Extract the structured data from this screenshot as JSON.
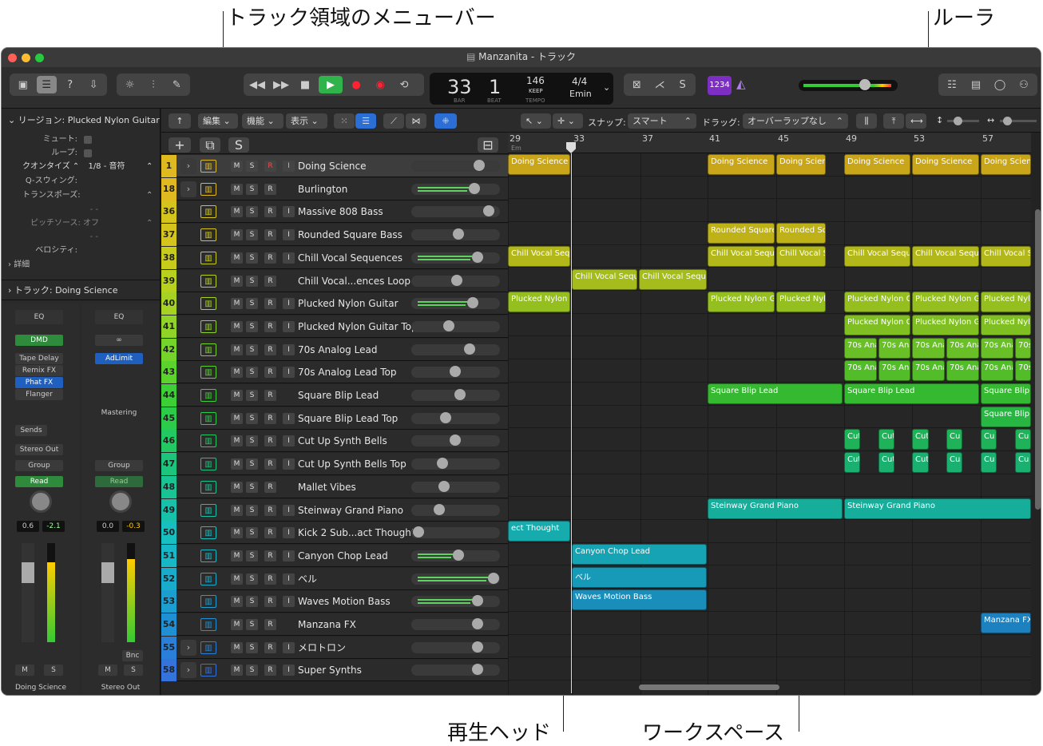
{
  "callouts": {
    "menu": "トラック領域のメニューバー",
    "ruler": "ルーラ",
    "playhead": "再生ヘッド",
    "workspace": "ワークスペース"
  },
  "window": {
    "title": "Manzanita - トラック"
  },
  "lcd": {
    "bar": "33",
    "beat": "1",
    "bar_label": "BAR",
    "beat_label": "BEAT",
    "tempo": "146",
    "tempo_mode": "KEEP",
    "tempo_label": "TEMPO",
    "sig": "4/4",
    "key": "Emin"
  },
  "toolbar": {
    "count_in": "1234"
  },
  "inspector": {
    "region_header": "リージョン: Plucked Nylon Guitar",
    "mute": "ミュート:",
    "loop": "ループ:",
    "quantize": "クオンタイズ",
    "quantize_value": "1/8 - 音符",
    "qswing": "Q-スウィング:",
    "transpose": "トランスポーズ:",
    "dash1": "- -",
    "pitch_source": "ピッチソース: オフ",
    "dash2": "- -",
    "velocity": "ベロシティ:",
    "details": "詳細",
    "track_header": "トラック: Doing Science"
  },
  "strip1": {
    "eq": "EQ",
    "fx": [
      "DMD",
      "Tape Delay",
      "Remix FX",
      "Phat FX",
      "Flanger"
    ],
    "sends": "Sends",
    "out": "Stereo Out",
    "group": "Group",
    "auto": "Read",
    "vol": "0.6",
    "peak": "-2.1",
    "m": "M",
    "s": "S",
    "name": "Doing Science"
  },
  "strip2": {
    "eq": "EQ",
    "fx": [
      "AdLimit"
    ],
    "mastering": "Mastering",
    "group": "Group",
    "auto": "Read",
    "vol": "0.0",
    "peak": "-0.3",
    "bnc": "Bnc",
    "m": "M",
    "s": "S",
    "name": "Stereo Out"
  },
  "menubar": {
    "edit": "編集",
    "func": "機能",
    "view": "表示",
    "snap_label": "スナップ:",
    "snap": "スマート",
    "drag_label": "ドラッグ:",
    "drag": "オーバーラップなし"
  },
  "headerbar": {
    "add": "+",
    "dup": "⧉",
    "solo": "S"
  },
  "ruler": {
    "bars": [
      "29",
      "33",
      "37",
      "41",
      "45",
      "49",
      "53",
      "57"
    ],
    "key": "Em"
  },
  "tracks": [
    {
      "num": "1",
      "name": "Doing Science",
      "color": "#e0b81f"
    },
    {
      "num": "18",
      "name": "Burlington",
      "color": "#e0b81f"
    },
    {
      "num": "36",
      "name": "Massive 808 Bass",
      "color": "#d4c41b"
    },
    {
      "num": "37",
      "name": "Rounded Square Bass",
      "color": "#d4c41b"
    },
    {
      "num": "38",
      "name": "Chill Vocal Sequences",
      "color": "#c7cc1c"
    },
    {
      "num": "39",
      "name": "Chill Vocal...ences Loop",
      "color": "#b8d11f"
    },
    {
      "num": "40",
      "name": "Plucked Nylon Guitar",
      "color": "#a6d323"
    },
    {
      "num": "41",
      "name": "Plucked Nylon Guitar Top",
      "color": "#8fd426"
    },
    {
      "num": "42",
      "name": "70s Analog Lead",
      "color": "#74d42a"
    },
    {
      "num": "43",
      "name": "70s Analog Lead Top",
      "color": "#5cd32d"
    },
    {
      "num": "44",
      "name": "Square Blip Lead",
      "color": "#3ccf36"
    },
    {
      "num": "45",
      "name": "Square Blip Lead Top",
      "color": "#2ccc4a"
    },
    {
      "num": "46",
      "name": "Cut Up Synth Bells",
      "color": "#22c862"
    },
    {
      "num": "47",
      "name": "Cut Up Synth Bells Top",
      "color": "#1cc47c"
    },
    {
      "num": "48",
      "name": "Mallet Vibes",
      "color": "#1ac394"
    },
    {
      "num": "49",
      "name": "Steinway Grand Piano",
      "color": "#18c1aa"
    },
    {
      "num": "50",
      "name": "Kick 2 Sub...act Thought",
      "color": "#18bfc0"
    },
    {
      "num": "51",
      "name": "Canyon Chop Lead",
      "color": "#18b7c8"
    },
    {
      "num": "52",
      "name": "ベル",
      "color": "#19abcc"
    },
    {
      "num": "53",
      "name": "Waves Motion Bass",
      "color": "#1c9fd0"
    },
    {
      "num": "54",
      "name": "Manzana FX",
      "color": "#2090d4"
    },
    {
      "num": "55",
      "name": "メロトロン",
      "color": "#2a80d8"
    },
    {
      "num": "58",
      "name": "Super Synths",
      "color": "#3472dc"
    }
  ],
  "regions": [
    {
      "lane": 0,
      "name": "Doing Science",
      "from": 0,
      "to": 78,
      "c": "#c9a51a"
    },
    {
      "lane": 0,
      "name": "Doing Science",
      "from": 250,
      "to": 334,
      "c": "#c9a51a"
    },
    {
      "lane": 0,
      "name": "Doing Science",
      "from": 336,
      "to": 398,
      "c": "#c9a51a"
    },
    {
      "lane": 0,
      "name": "Doing Science",
      "from": 421,
      "to": 504,
      "c": "#c9a51a"
    },
    {
      "lane": 0,
      "name": "Doing Science",
      "from": 506,
      "to": 590,
      "c": "#c9a51a"
    },
    {
      "lane": 0,
      "name": "Doing Science",
      "from": 592,
      "to": 655,
      "c": "#c9a51a"
    },
    {
      "lane": 3,
      "name": "Rounded Square",
      "from": 250,
      "to": 334,
      "c": "#bfb218"
    },
    {
      "lane": 3,
      "name": "Rounded Sq",
      "from": 336,
      "to": 398,
      "c": "#bfb218"
    },
    {
      "lane": 4,
      "name": "Chill Vocal Seque",
      "from": 0,
      "to": 78,
      "c": "#b3b81a"
    },
    {
      "lane": 4,
      "name": "Chill Vocal Seque",
      "from": 250,
      "to": 334,
      "c": "#b3b81a"
    },
    {
      "lane": 4,
      "name": "Chill Vocal S",
      "from": 336,
      "to": 398,
      "c": "#b3b81a"
    },
    {
      "lane": 4,
      "name": "Chill Vocal Seque",
      "from": 421,
      "to": 504,
      "c": "#b3b81a"
    },
    {
      "lane": 4,
      "name": "Chill Vocal Seque",
      "from": 506,
      "to": 590,
      "c": "#b3b81a"
    },
    {
      "lane": 4,
      "name": "Chill Vocal Se",
      "from": 592,
      "to": 655,
      "c": "#b3b81a"
    },
    {
      "lane": 5,
      "name": "Chill Vocal Seque",
      "from": 80,
      "to": 162,
      "c": "#a5bc1c"
    },
    {
      "lane": 5,
      "name": "Chill Vocal Seque",
      "from": 164,
      "to": 249,
      "c": "#a5bc1c"
    },
    {
      "lane": 6,
      "name": "Plucked Nylon G",
      "from": 0,
      "to": 78,
      "c": "#95be1f"
    },
    {
      "lane": 6,
      "name": "Plucked Nylon G",
      "from": 250,
      "to": 334,
      "c": "#95be1f"
    },
    {
      "lane": 6,
      "name": "Plucked Nyl",
      "from": 336,
      "to": 398,
      "c": "#95be1f"
    },
    {
      "lane": 6,
      "name": "Plucked Nylon G",
      "from": 421,
      "to": 504,
      "c": "#95be1f"
    },
    {
      "lane": 6,
      "name": "Plucked Nylon Gu",
      "from": 506,
      "to": 590,
      "c": "#95be1f"
    },
    {
      "lane": 6,
      "name": "Plucked Nylo",
      "from": 592,
      "to": 655,
      "c": "#95be1f"
    },
    {
      "lane": 7,
      "name": "Plucked Nylon G",
      "from": 421,
      "to": 504,
      "c": "#80bf22"
    },
    {
      "lane": 7,
      "name": "Plucked Nylon Gu",
      "from": 506,
      "to": 590,
      "c": "#80bf22"
    },
    {
      "lane": 7,
      "name": "Plucked Nylo",
      "from": 592,
      "to": 655,
      "c": "#80bf22"
    },
    {
      "lane": 8,
      "name": "70s Ana",
      "from": 421,
      "to": 462,
      "c": "#68bf26"
    },
    {
      "lane": 8,
      "name": "70s Ana",
      "from": 464,
      "to": 504,
      "c": "#68bf26"
    },
    {
      "lane": 8,
      "name": "70s Ana",
      "from": 506,
      "to": 547,
      "c": "#68bf26"
    },
    {
      "lane": 8,
      "name": "70s Ana",
      "from": 549,
      "to": 590,
      "c": "#68bf26"
    },
    {
      "lane": 8,
      "name": "70s Ana",
      "from": 592,
      "to": 633,
      "c": "#68bf26"
    },
    {
      "lane": 8,
      "name": "70s",
      "from": 635,
      "to": 655,
      "c": "#68bf26"
    },
    {
      "lane": 9,
      "name": "70s Ana",
      "from": 421,
      "to": 462,
      "c": "#52bd29"
    },
    {
      "lane": 9,
      "name": "70s Ana",
      "from": 464,
      "to": 504,
      "c": "#52bd29"
    },
    {
      "lane": 9,
      "name": "70s Ana",
      "from": 506,
      "to": 547,
      "c": "#52bd29"
    },
    {
      "lane": 9,
      "name": "70s Ana",
      "from": 549,
      "to": 590,
      "c": "#52bd29"
    },
    {
      "lane": 9,
      "name": "70s Ana",
      "from": 592,
      "to": 633,
      "c": "#52bd29"
    },
    {
      "lane": 9,
      "name": "70s",
      "from": 635,
      "to": 655,
      "c": "#52bd29"
    },
    {
      "lane": 10,
      "name": "Square Blip Lead",
      "from": 250,
      "to": 419,
      "c": "#35b930"
    },
    {
      "lane": 10,
      "name": "Square Blip Lead",
      "from": 421,
      "to": 590,
      "c": "#35b930"
    },
    {
      "lane": 10,
      "name": "Square Blip",
      "from": 592,
      "to": 655,
      "c": "#35b930"
    },
    {
      "lane": 11,
      "name": "Square Blip L",
      "from": 592,
      "to": 655,
      "c": "#27b642"
    },
    {
      "lane": 12,
      "name": "Cut",
      "from": 421,
      "to": 441,
      "c": "#1eb358"
    },
    {
      "lane": 12,
      "name": "Cut",
      "from": 464,
      "to": 484,
      "c": "#1eb358"
    },
    {
      "lane": 12,
      "name": "Cut",
      "from": 506,
      "to": 527,
      "c": "#1eb358"
    },
    {
      "lane": 12,
      "name": "Cu",
      "from": 549,
      "to": 569,
      "c": "#1eb358"
    },
    {
      "lane": 12,
      "name": "Cu",
      "from": 592,
      "to": 612,
      "c": "#1eb358"
    },
    {
      "lane": 12,
      "name": "Cu",
      "from": 635,
      "to": 655,
      "c": "#1eb358"
    },
    {
      "lane": 13,
      "name": "Cut",
      "from": 421,
      "to": 441,
      "c": "#19b070"
    },
    {
      "lane": 13,
      "name": "Cut",
      "from": 464,
      "to": 484,
      "c": "#19b070"
    },
    {
      "lane": 13,
      "name": "Cut",
      "from": 506,
      "to": 527,
      "c": "#19b070"
    },
    {
      "lane": 13,
      "name": "Cu",
      "from": 549,
      "to": 569,
      "c": "#19b070"
    },
    {
      "lane": 13,
      "name": "Cu",
      "from": 592,
      "to": 612,
      "c": "#19b070"
    },
    {
      "lane": 13,
      "name": "Cu",
      "from": 635,
      "to": 655,
      "c": "#19b070"
    },
    {
      "lane": 15,
      "name": "Steinway Grand Piano",
      "from": 250,
      "to": 419,
      "c": "#16ad9a"
    },
    {
      "lane": 15,
      "name": "Steinway Grand Piano",
      "from": 421,
      "to": 655,
      "c": "#16ad9a"
    },
    {
      "lane": 16,
      "name": "ect Thought",
      "from": 0,
      "to": 78,
      "c": "#16abac"
    },
    {
      "lane": 17,
      "name": "Canyon Chop Lead",
      "from": 80,
      "to": 249,
      "c": "#16a4b4"
    },
    {
      "lane": 18,
      "name": "ベル",
      "from": 80,
      "to": 249,
      "c": "#1799b8"
    },
    {
      "lane": 19,
      "name": "Waves Motion Bass",
      "from": 80,
      "to": 249,
      "c": "#198ebb"
    },
    {
      "lane": 20,
      "name": "Manzana FX",
      "from": 592,
      "to": 655,
      "c": "#1d81bf"
    }
  ]
}
